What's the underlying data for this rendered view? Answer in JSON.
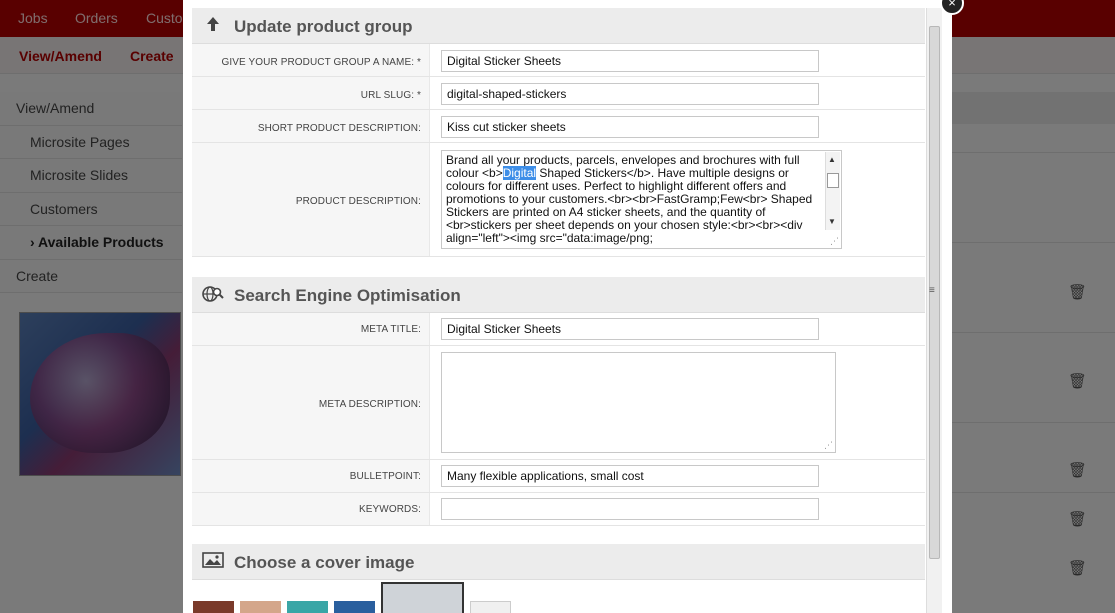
{
  "topnav": {
    "items": [
      "Jobs",
      "Orders",
      "Custo"
    ]
  },
  "subnav": {
    "items": [
      "View/Amend",
      "Create"
    ]
  },
  "sidebar": {
    "items": [
      {
        "label": "View/Amend",
        "level": "main"
      },
      {
        "label": "Microsite Pages",
        "level": "sub"
      },
      {
        "label": "Microsite Slides",
        "level": "sub"
      },
      {
        "label": "Customers",
        "level": "sub"
      },
      {
        "label": "› Available Products",
        "level": "sub",
        "active": true
      },
      {
        "label": "Create",
        "level": "main"
      }
    ]
  },
  "modal": {
    "close_icon": "×",
    "sections": {
      "update": {
        "title": "Update product group",
        "icon": "arrow-up-icon"
      },
      "seo": {
        "title": "Search Engine Optimisation",
        "icon": "globe-search-icon"
      },
      "cover": {
        "title": "Choose a cover image",
        "icon": "image-icon"
      }
    },
    "fields": {
      "name": {
        "label": "GIVE YOUR PRODUCT GROUP A NAME: *",
        "value": "Digital Sticker Sheets"
      },
      "slug": {
        "label": "URL SLUG: *",
        "value": "digital-shaped-stickers"
      },
      "short_desc": {
        "label": "SHORT PRODUCT DESCRIPTION:",
        "value": "Kiss cut sticker sheets"
      },
      "desc": {
        "label": "PRODUCT DESCRIPTION:",
        "before": "Brand all your products, parcels, envelopes and brochures with full colour <b>",
        "highlight": "Digital",
        "after": " Shaped Stickers</b>. Have multiple designs or colours for different uses. Perfect to highlight different offers and promotions to your customers.<br><br>FastGramp;Few<br> Shaped Stickers are printed on A4 sticker sheets, and the quantity of <br>stickers per sheet depends on your chosen style:<br><br><div align=\"left\"><img src=\"data:image/png;"
      },
      "meta_title": {
        "label": "META TITLE:",
        "value": "Digital Sticker Sheets"
      },
      "meta_desc": {
        "label": "META DESCRIPTION:",
        "value": ""
      },
      "bulletpoint": {
        "label": "BULLETPOINT:",
        "value": "Many flexible applications, small cost"
      },
      "keywords": {
        "label": "KEYWORDS:",
        "value": ""
      }
    }
  },
  "colors": {
    "brand": "#b30000",
    "highlight": "#3d8ee8"
  }
}
